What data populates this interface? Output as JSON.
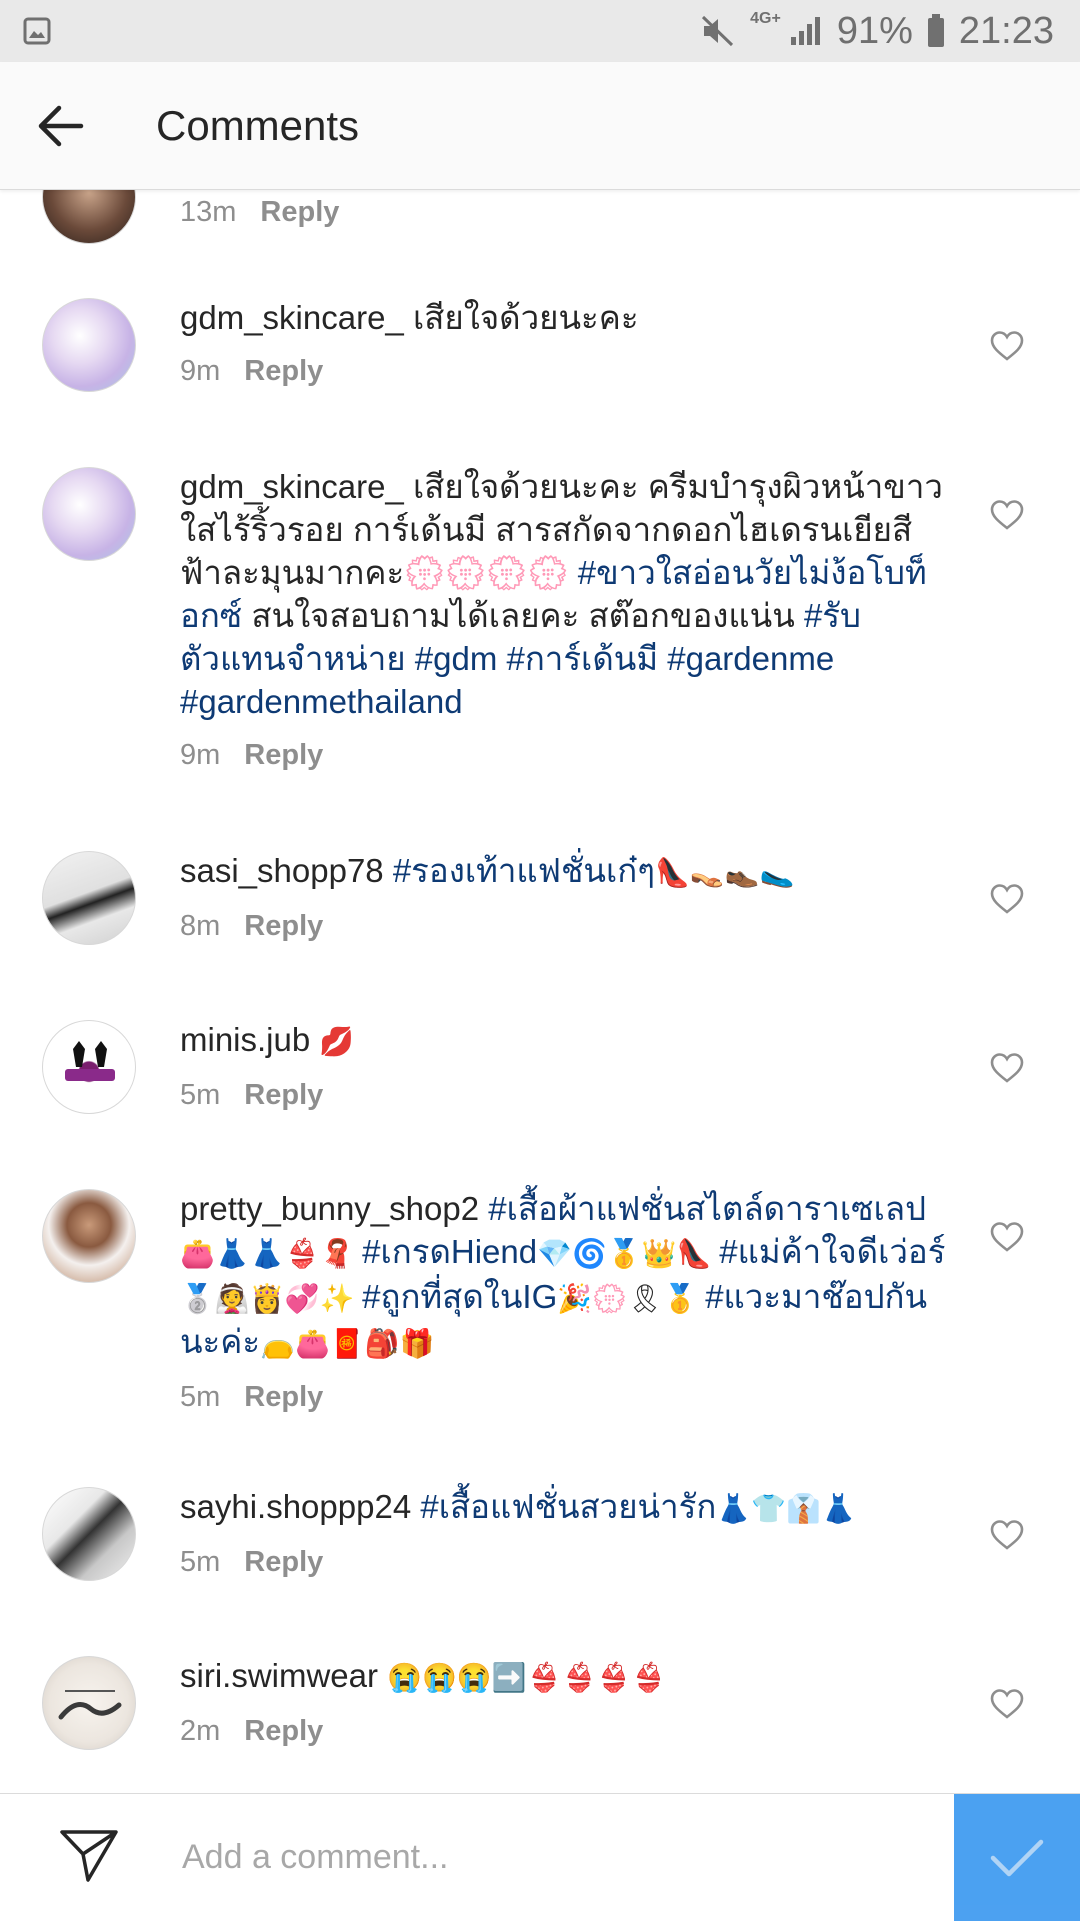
{
  "status_bar": {
    "network": "4G+",
    "battery": "91%",
    "time": "21:23"
  },
  "header": {
    "title": "Comments"
  },
  "comments": [
    {
      "username": "",
      "text_parts": [],
      "time": "13m",
      "reply_label": "Reply"
    },
    {
      "username": "gdm_skincare_",
      "text_parts": [
        {
          "t": "เสียใจด้วยนะคะ",
          "tag": false
        }
      ],
      "time": "9m",
      "reply_label": "Reply"
    },
    {
      "username": "gdm_skincare_",
      "text_parts": [
        {
          "t": "เสียใจด้วยนะคะ ครีมบำรุงผิวหน้าขาวใสไร้ริ้วรอย การ์เด้นมี สารสกัดจากดอกไฮเดรนเยียสีฟ้าละมุนมากคะ💮💮💮💮 ",
          "tag": false
        },
        {
          "t": "#ขาวใสอ่อนวัยไม่ง้อโบท็อกซ์",
          "tag": true
        },
        {
          "t": " สนใจสอบถามได้เลยคะ สต๊อกของแน่น ",
          "tag": false
        },
        {
          "t": "#รับตัวแทนจำหน่าย #gdm #การ์เด้นมี #gardenme #gardenmethailand",
          "tag": true
        }
      ],
      "time": "9m",
      "reply_label": "Reply"
    },
    {
      "username": "sasi_shopp78",
      "text_parts": [
        {
          "t": "#รองเท้าแฟชั่นเก๋ๆ",
          "tag": true
        },
        {
          "t": "👠👡👞🥿",
          "tag": false
        }
      ],
      "time": "8m",
      "reply_label": "Reply"
    },
    {
      "username": "minis.jub",
      "text_parts": [
        {
          "t": "💋",
          "tag": false
        }
      ],
      "time": "5m",
      "reply_label": "Reply"
    },
    {
      "username": "pretty_bunny_shop2",
      "text_parts": [
        {
          "t": "#เสื้อผ้าแฟชั่นสไตล์ดาราเซเลป",
          "tag": true
        },
        {
          "t": "👛👗👗👙🧣 ",
          "tag": false
        },
        {
          "t": "#เกรดHiend",
          "tag": true
        },
        {
          "t": "💎🌀🥇👑👠 ",
          "tag": false
        },
        {
          "t": "#แม่ค้าใจดีเว่อร์",
          "tag": true
        },
        {
          "t": "🥈👰👸💞✨ ",
          "tag": false
        },
        {
          "t": "#ถูกที่สุดในIG",
          "tag": true
        },
        {
          "t": "🎉💮🎗🥇 ",
          "tag": false
        },
        {
          "t": "#แวะมาช๊อปกันนะค่ะ",
          "tag": true
        },
        {
          "t": "👝👛🧧🎒🎁",
          "tag": false
        }
      ],
      "time": "5m",
      "reply_label": "Reply"
    },
    {
      "username": "sayhi.shoppp24",
      "text_parts": [
        {
          "t": "#เสื้อแฟชั่นสวยน่ารัก",
          "tag": true
        },
        {
          "t": "👗👕👔👗",
          "tag": false
        }
      ],
      "time": "5m",
      "reply_label": "Reply"
    },
    {
      "username": "siri.swimwear",
      "text_parts": [
        {
          "t": "😭😭😭➡️👙👙👙👙",
          "tag": false
        }
      ],
      "time": "2m",
      "reply_label": "Reply"
    }
  ],
  "compose": {
    "placeholder": "Add a comment..."
  },
  "colors": {
    "hashtag": "#0e3a74",
    "post_button": "#3897f0",
    "muted": "#8e8e8e"
  }
}
